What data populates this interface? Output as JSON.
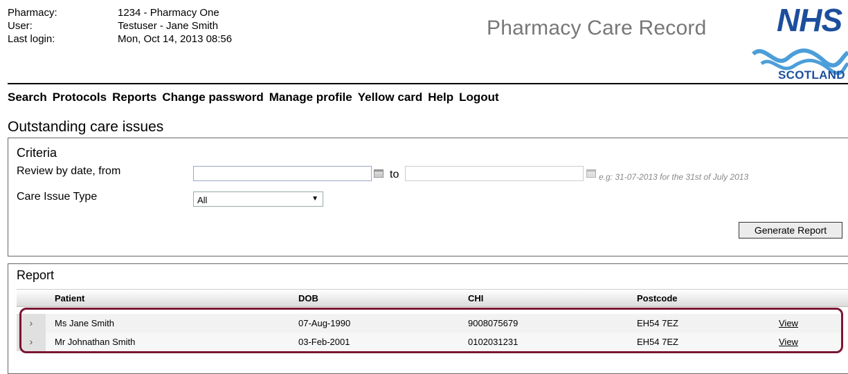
{
  "header": {
    "pharmacy_label": "Pharmacy:",
    "pharmacy_value": "1234 - Pharmacy One",
    "user_label": "User:",
    "user_value": "Testuser - Jane Smith",
    "last_login_label": "Last login:",
    "last_login_value": "Mon, Oct 14, 2013 08:56",
    "app_title": "Pharmacy Care Record",
    "logo_nhs": "NHS",
    "logo_scotland": "SCOTLAND"
  },
  "nav": [
    "Search",
    "Protocols",
    "Reports",
    "Change password",
    "Manage profile",
    "Yellow card",
    "Help",
    "Logout"
  ],
  "page_title": "Outstanding care issues",
  "criteria": {
    "title": "Criteria",
    "review_label": "Review by date, from",
    "from_value": "",
    "to_label": "to",
    "to_value": "",
    "date_hint": "e.g: 31-07-2013 for the 31st of July 2013",
    "care_issue_label": "Care Issue Type",
    "care_issue_selected": "All",
    "generate_button": "Generate Report"
  },
  "report": {
    "title": "Report",
    "columns": [
      "Patient",
      "DOB",
      "CHI",
      "Postcode"
    ],
    "rows": [
      {
        "patient": "Ms Jane Smith",
        "dob": "07-Aug-1990",
        "chi": "9008075679",
        "postcode": "EH54 7EZ",
        "action": "View"
      },
      {
        "patient": "Mr Johnathan Smith",
        "dob": "03-Feb-2001",
        "chi": "0102031231",
        "postcode": "EH54 7EZ",
        "action": "View"
      }
    ]
  },
  "colors": {
    "nhs_blue": "#1c4e9c",
    "highlight": "#7a1631"
  },
  "icons": [
    "calendar-icon",
    "chevron-down-icon",
    "expand-row-icon"
  ]
}
